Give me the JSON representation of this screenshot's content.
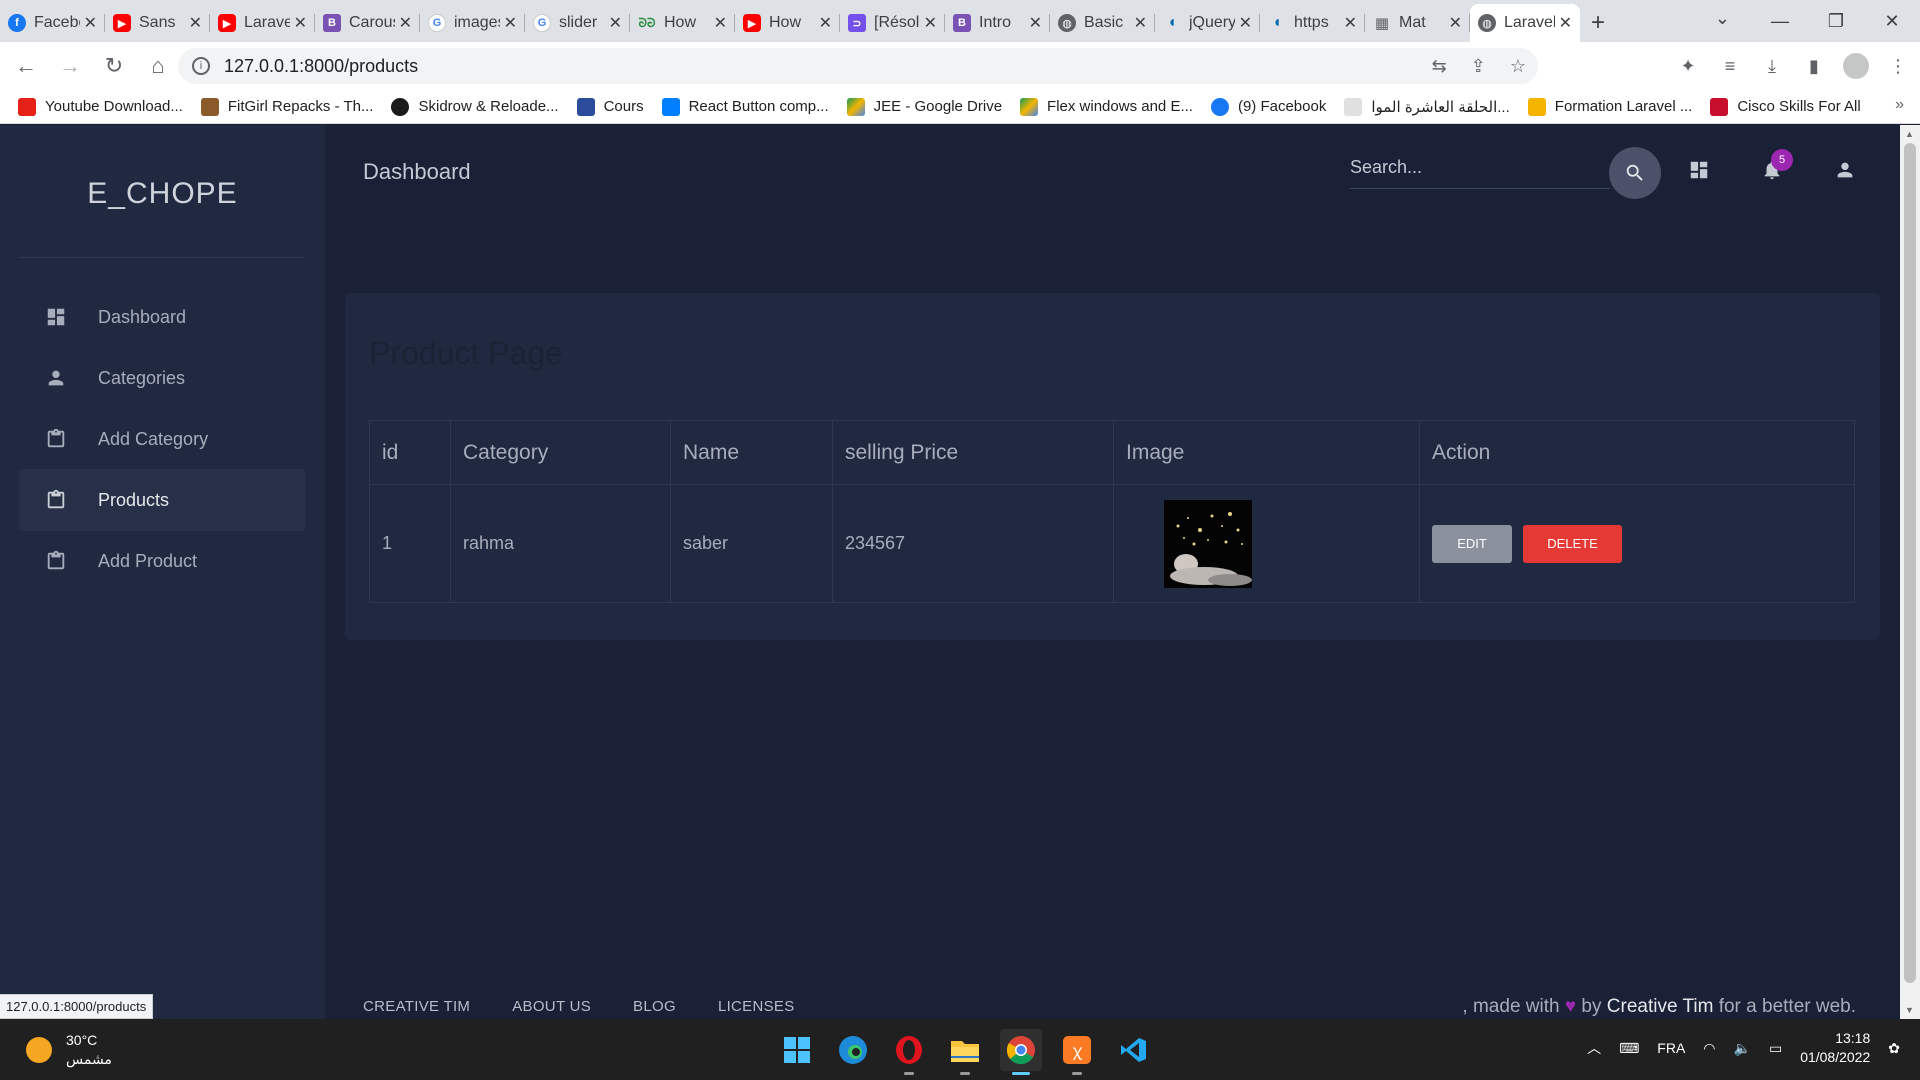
{
  "browser": {
    "tabs": [
      {
        "title": "Facebook",
        "icon": "facebook-icon",
        "color": "#1877f2"
      },
      {
        "title": "Sans",
        "icon": "youtube-icon",
        "color": "#ff0000"
      },
      {
        "title": "Laravel",
        "icon": "youtube-icon",
        "color": "#ff0000"
      },
      {
        "title": "Carousel",
        "icon": "bootstrap-icon",
        "color": "#7952b3"
      },
      {
        "title": "images",
        "icon": "google-icon",
        "color": "#4285f4"
      },
      {
        "title": "slider",
        "icon": "google-icon",
        "color": "#4285f4"
      },
      {
        "title": "How",
        "icon": "geeksforgeeks-icon",
        "color": "#2f8d46"
      },
      {
        "title": "How",
        "icon": "youtube-icon",
        "color": "#ff0000"
      },
      {
        "title": "[Résolu]",
        "icon": "openclassrooms-icon",
        "color": "#7451eb"
      },
      {
        "title": "Intro",
        "icon": "bootstrap-icon",
        "color": "#7952b3"
      },
      {
        "title": "Basic",
        "icon": "globe-icon",
        "color": "#5f6368"
      },
      {
        "title": "jQuery",
        "icon": "jquery-icon",
        "color": "#0769ad"
      },
      {
        "title": "https",
        "icon": "jquery-icon",
        "color": "#0769ad"
      },
      {
        "title": "Mat",
        "icon": "material-icon",
        "color": "#5f6368"
      },
      {
        "title": "Laravel",
        "icon": "globe-icon",
        "color": "#5f6368",
        "active": true
      }
    ],
    "url": "127.0.0.1:8000/products",
    "bookmarks": [
      {
        "label": "Youtube Download...",
        "color": "#e62117"
      },
      {
        "label": "FitGirl Repacks - Th...",
        "color": "#8b5a2b"
      },
      {
        "label": "Skidrow & Reloade...",
        "color": "#1a1a1a"
      },
      {
        "label": "Cours",
        "color": "#2b4c9b"
      },
      {
        "label": "React Button comp...",
        "color": "#007fff"
      },
      {
        "label": "JEE - Google Drive",
        "color": "#0f9d58"
      },
      {
        "label": "Flex windows and E...",
        "color": "#0f9d58"
      },
      {
        "label": "(9) Facebook",
        "color": "#1877f2"
      },
      {
        "label": "الحلقة العاشرة الموا...",
        "color": "#e0e0e0"
      },
      {
        "label": "Formation Laravel ...",
        "color": "#f4b400"
      },
      {
        "label": "Cisco Skills For All",
        "color": "#c8102e"
      }
    ],
    "status_url": "127.0.0.1:8000/products"
  },
  "sidebar": {
    "brand": "E_CHOPE",
    "items": [
      {
        "label": "Dashboard",
        "icon": "dashboard-icon"
      },
      {
        "label": "Categories",
        "icon": "person-icon"
      },
      {
        "label": "Add Category",
        "icon": "clipboard-icon"
      },
      {
        "label": "Products",
        "icon": "clipboard-icon",
        "active": true
      },
      {
        "label": "Add Product",
        "icon": "clipboard-icon"
      }
    ]
  },
  "topnav": {
    "title": "Dashboard",
    "search_placeholder": "Search...",
    "notification_count": "5"
  },
  "card": {
    "title": "Product Page",
    "columns": [
      "id",
      "Category",
      "Name",
      "selling Price",
      "Image",
      "Action"
    ],
    "rows": [
      {
        "id": "1",
        "category": "rahma",
        "name": "saber",
        "price": "234567",
        "edit": "EDIT",
        "delete": "DELETE"
      }
    ]
  },
  "footer": {
    "links": [
      "CREATIVE TIM",
      "ABOUT US",
      "BLOG",
      "LICENSES"
    ],
    "copy_prefix": ", made with",
    "copy_by": "by",
    "copy_author": "Creative Tim",
    "copy_suffix": "for a better web."
  },
  "taskbar": {
    "temperature": "30°C",
    "weather_text": "مشمس",
    "language": "FRA",
    "time": "13:18",
    "date": "01/08/2022"
  },
  "colors": {
    "page_bg": "#1a2035",
    "sidebar_bg": "#202940",
    "card_bg": "#202940",
    "delete_red": "#e53935",
    "edit_gray": "#8a909c",
    "badge_purple": "#9c27b0"
  }
}
